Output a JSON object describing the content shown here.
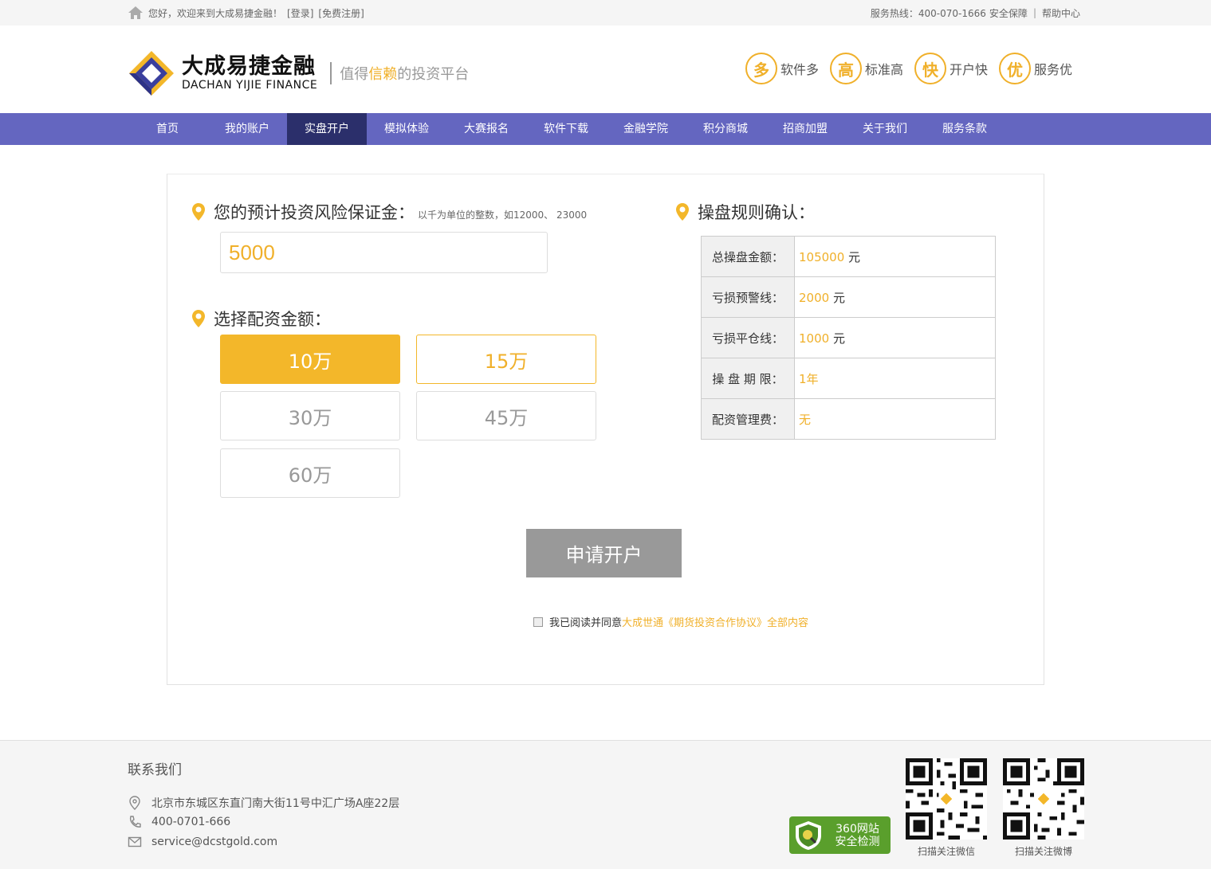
{
  "topbar": {
    "welcome": "您好，欢迎来到大成易捷金融！",
    "login": "[登录]",
    "register": "[免费注册]",
    "hotline": "服务热线：400-070-1666",
    "security": "安全保障",
    "sep": "|",
    "help": "帮助中心"
  },
  "header": {
    "logo_cn": "大成易捷金融",
    "logo_en": "DACHAN YIJIE FINANCE",
    "slogan_pre": "值得",
    "slogan_hl": "信赖",
    "slogan_post": "的投资平台",
    "features": [
      {
        "icon": "多",
        "label": "软件多"
      },
      {
        "icon": "高",
        "label": "标准高"
      },
      {
        "icon": "快",
        "label": "开户快"
      },
      {
        "icon": "优",
        "label": "服务优"
      }
    ]
  },
  "nav": {
    "items": [
      "首页",
      "我的账户",
      "实盘开户",
      "模拟体验",
      "大赛报名",
      "软件下载",
      "金融学院",
      "积分商城",
      "招商加盟",
      "关于我们",
      "服务条款"
    ],
    "active": "实盘开户"
  },
  "form": {
    "margin_title": "您的预计投资风险保证金：",
    "margin_hint": "以千为单位的整数，如12000、 23000",
    "margin_value": "5000",
    "amount_title": "选择配资金额：",
    "options": [
      "10万",
      "15万",
      "30万",
      "45万",
      "60万"
    ],
    "selected": "10万",
    "apply_label": "申请开户",
    "agree_pre": "我已阅读并同意",
    "agree_link": "大成世通《期货投资合作协议》全部内容"
  },
  "rules": {
    "title": "操盘规则确认：",
    "rows": [
      {
        "key": "总操盘金额：",
        "value": "105000",
        "unit": " 元"
      },
      {
        "key": "亏损预警线：",
        "value": "2000",
        "unit": " 元"
      },
      {
        "key": "亏损平仓线：",
        "value": "1000",
        "unit": " 元"
      },
      {
        "key": "操 盘 期 限：",
        "value": "1年",
        "unit": ""
      },
      {
        "key": "配资管理费：",
        "value": "无",
        "unit": ""
      }
    ]
  },
  "footer": {
    "title": "联系我们",
    "address": "北京市东城区东直门南大街11号中汇广场A座22层",
    "phone": "400-0701-666",
    "email": "service@dcstgold.com",
    "badge_line1": "360网站",
    "badge_line2": "安全检测",
    "qr_wechat": "扫描关注微信",
    "qr_weibo": "扫描关注微博"
  },
  "colors": {
    "accent": "#f0b02a",
    "nav": "#6466c0",
    "nav_active": "#2b2f6b"
  }
}
